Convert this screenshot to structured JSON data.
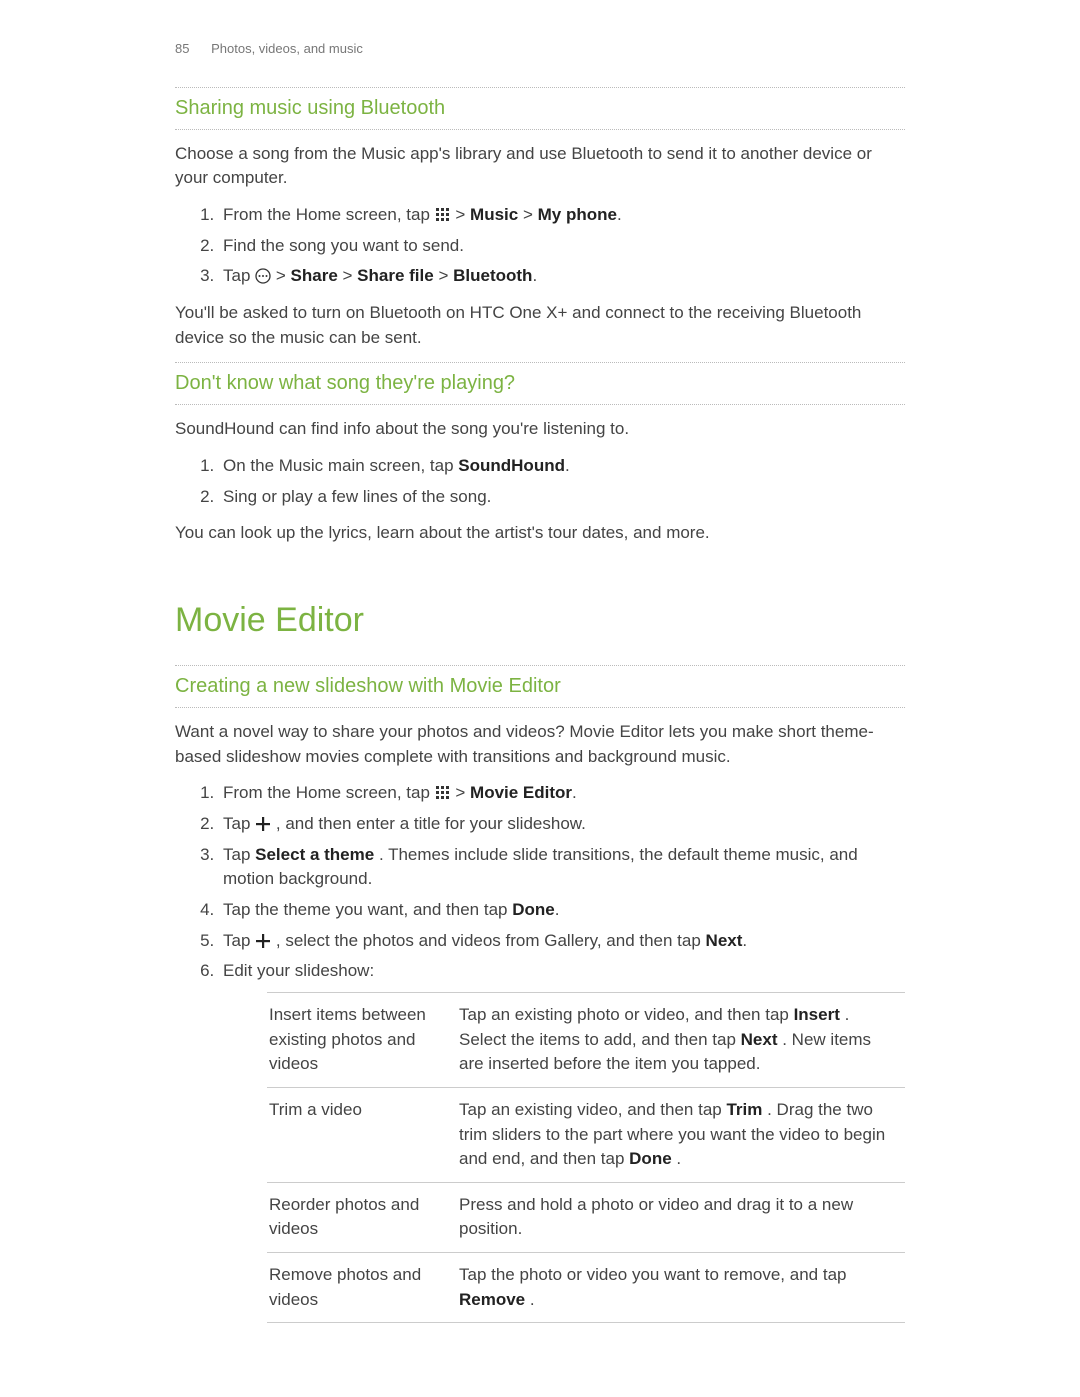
{
  "header": {
    "page_number": "85",
    "running_title": "Photos, videos, and music"
  },
  "section1": {
    "heading": "Sharing music using Bluetooth",
    "intro": "Choose a song from the Music app's library and use Bluetooth to send it to another device or your computer.",
    "steps": {
      "s1_pre": "From the Home screen, tap ",
      "s1_mid": " > ",
      "s1_music": "Music",
      "s1_myphone": "My phone",
      "s1_end": ".",
      "s2": "Find the song you want to send.",
      "s3_pre": "Tap ",
      "s3_mid1": " > ",
      "s3_share": "Share",
      "s3_mid2": " > ",
      "s3_sharefile": "Share file",
      "s3_mid3": " > ",
      "s3_bluetooth": "Bluetooth",
      "s3_end": "."
    },
    "outro": "You'll be asked to turn on Bluetooth on HTC One X+ and connect to the receiving Bluetooth device so the music can be sent."
  },
  "section2": {
    "heading": "Don't know what song they're playing?",
    "intro": "SoundHound can find info about the song you're listening to.",
    "steps": {
      "s1_pre": "On the Music main screen, tap ",
      "s1_bold": "SoundHound",
      "s1_end": ".",
      "s2": "Sing or play a few lines of the song."
    },
    "outro": "You can look up the lyrics, learn about the artist's tour dates, and more."
  },
  "movie_editor": {
    "title": "Movie Editor",
    "sub3": {
      "heading": "Creating a new slideshow with Movie Editor",
      "intro": "Want a novel way to share your photos and videos? Movie Editor lets you make short theme-based slideshow movies complete with transitions and background music.",
      "steps": {
        "s1_pre": "From the Home screen, tap ",
        "s1_mid": " > ",
        "s1_bold": "Movie Editor",
        "s1_end": ".",
        "s2_pre": "Tap ",
        "s2_post": ", and then enter a title for your slideshow.",
        "s3_pre": "Tap ",
        "s3_bold": "Select a theme",
        "s3_post": ". Themes include slide transitions, the default theme music, and motion background.",
        "s4_pre": "Tap the theme you want, and then tap ",
        "s4_bold": "Done",
        "s4_end": ".",
        "s5_pre": "Tap ",
        "s5_mid": ", select the photos and videos from Gallery, and then tap ",
        "s5_bold": "Next",
        "s5_end": ".",
        "s6": "Edit your slideshow:"
      },
      "table": [
        {
          "label": "Insert items between existing photos and videos",
          "pre": "Tap an existing photo or video, and then tap ",
          "b1": "Insert",
          "mid": ". Select the items to add, and then tap ",
          "b2": "Next",
          "post": ". New items are inserted before the item you tapped."
        },
        {
          "label": "Trim a video",
          "pre": "Tap an existing video, and then tap ",
          "b1": "Trim",
          "mid": ". Drag the two trim sliders to the part where you want the video to begin and end, and then tap ",
          "b2": "Done",
          "post": "."
        },
        {
          "label": "Reorder photos and videos",
          "pre": "Press and hold a photo or video and drag it to a new position.",
          "b1": "",
          "mid": "",
          "b2": "",
          "post": ""
        },
        {
          "label": "Remove photos and videos",
          "pre": "Tap the photo or video you want to remove, and tap ",
          "b1": "Remove",
          "mid": ".",
          "b2": "",
          "post": ""
        }
      ]
    }
  }
}
